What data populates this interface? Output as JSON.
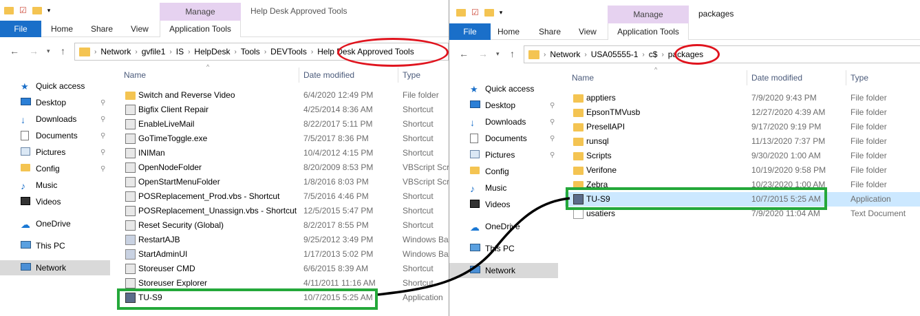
{
  "left_window": {
    "manage_tab": "Manage",
    "title": "Help Desk Approved Tools",
    "ribbon_tabs": [
      "File",
      "Home",
      "Share",
      "View",
      "Application Tools"
    ],
    "breadcrumb": [
      "Network",
      "gvfile1",
      "IS",
      "HelpDesk",
      "Tools",
      "DEVTools",
      "Help Desk Approved Tools"
    ],
    "columns": {
      "name": "Name",
      "date": "Date modified",
      "type": "Type"
    },
    "nav": [
      {
        "label": "Quick access",
        "icon": "star-icon",
        "pinned": false
      },
      {
        "label": "Desktop",
        "icon": "desktop-icon",
        "pinned": true
      },
      {
        "label": "Downloads",
        "icon": "download-icon",
        "pinned": true
      },
      {
        "label": "Documents",
        "icon": "documents-icon",
        "pinned": true
      },
      {
        "label": "Pictures",
        "icon": "pictures-icon",
        "pinned": true
      },
      {
        "label": "Config",
        "icon": "folder-icon",
        "pinned": true
      },
      {
        "label": "Music",
        "icon": "music-icon",
        "pinned": false
      },
      {
        "label": "Videos",
        "icon": "videos-icon",
        "pinned": false
      },
      {
        "label": "OneDrive",
        "icon": "cloud-icon",
        "pinned": false
      },
      {
        "label": "This PC",
        "icon": "computer-icon",
        "pinned": false
      },
      {
        "label": "Network",
        "icon": "network-icon",
        "pinned": false
      }
    ],
    "files": [
      {
        "name": "Switch and Reverse Video",
        "date": "6/4/2020 12:49 PM",
        "type": "File folder",
        "icon": "folder"
      },
      {
        "name": "Bigfix Client Repair",
        "date": "4/25/2014 8:36 AM",
        "type": "Shortcut",
        "icon": "sc"
      },
      {
        "name": "EnableLiveMail",
        "date": "8/22/2017 5:11 PM",
        "type": "Shortcut",
        "icon": "sc"
      },
      {
        "name": "GoTimeToggle.exe",
        "date": "7/5/2017 8:36 PM",
        "type": "Shortcut",
        "icon": "sc"
      },
      {
        "name": "INIMan",
        "date": "10/4/2012 4:15 PM",
        "type": "Shortcut",
        "icon": "sc"
      },
      {
        "name": "OpenNodeFolder",
        "date": "8/20/2009 8:53 PM",
        "type": "VBScript Scri",
        "icon": "sc"
      },
      {
        "name": "OpenStartMenuFolder",
        "date": "1/8/2016 8:03 PM",
        "type": "VBScript Scri",
        "icon": "sc"
      },
      {
        "name": "POSReplacement_Prod.vbs - Shortcut",
        "date": "7/5/2016 4:46 PM",
        "type": "Shortcut",
        "icon": "sc"
      },
      {
        "name": "POSReplacement_Unassign.vbs - Shortcut",
        "date": "12/5/2015 5:47 PM",
        "type": "Shortcut",
        "icon": "sc"
      },
      {
        "name": "Reset Security (Global)",
        "date": "8/2/2017 8:55 PM",
        "type": "Shortcut",
        "icon": "sc"
      },
      {
        "name": "RestartAJB",
        "date": "9/25/2012 3:49 PM",
        "type": "Windows Bat",
        "icon": "bat"
      },
      {
        "name": "StartAdminUI",
        "date": "1/17/2013 5:02 PM",
        "type": "Windows Bat",
        "icon": "bat"
      },
      {
        "name": "Storeuser CMD",
        "date": "6/6/2015 8:39 AM",
        "type": "Shortcut",
        "icon": "sc"
      },
      {
        "name": "Storeuser Explorer",
        "date": "4/11/2011 11:16 AM",
        "type": "Shortcut",
        "icon": "sc"
      },
      {
        "name": "TU-S9",
        "date": "10/7/2015 5:25 AM",
        "type": "Application",
        "icon": "app"
      }
    ]
  },
  "right_window": {
    "manage_tab": "Manage",
    "title": "packages",
    "ribbon_tabs": [
      "File",
      "Home",
      "Share",
      "View",
      "Application Tools"
    ],
    "breadcrumb": [
      "Network",
      "USA05555-1",
      "c$",
      "packages"
    ],
    "columns": {
      "name": "Name",
      "date": "Date modified",
      "type": "Type"
    },
    "nav": [
      {
        "label": "Quick access",
        "icon": "star-icon",
        "pinned": false
      },
      {
        "label": "Desktop",
        "icon": "desktop-icon",
        "pinned": true
      },
      {
        "label": "Downloads",
        "icon": "download-icon",
        "pinned": true
      },
      {
        "label": "Documents",
        "icon": "documents-icon",
        "pinned": true
      },
      {
        "label": "Pictures",
        "icon": "pictures-icon",
        "pinned": true
      },
      {
        "label": "Config",
        "icon": "folder-icon",
        "pinned": false
      },
      {
        "label": "Music",
        "icon": "music-icon",
        "pinned": false
      },
      {
        "label": "Videos",
        "icon": "videos-icon",
        "pinned": false
      },
      {
        "label": "OneDrive",
        "icon": "cloud-icon",
        "pinned": false
      },
      {
        "label": "This PC",
        "icon": "computer-icon",
        "pinned": false
      },
      {
        "label": "Network",
        "icon": "network-icon",
        "pinned": false
      }
    ],
    "files": [
      {
        "name": "apptiers",
        "date": "7/9/2020 9:43 PM",
        "type": "File folder",
        "icon": "folder"
      },
      {
        "name": "EpsonTMVusb",
        "date": "12/27/2020 4:39 AM",
        "type": "File folder",
        "icon": "folder"
      },
      {
        "name": "PresellAPI",
        "date": "9/17/2020 9:19 PM",
        "type": "File folder",
        "icon": "folder"
      },
      {
        "name": "runsql",
        "date": "11/13/2020 7:37 PM",
        "type": "File folder",
        "icon": "folder"
      },
      {
        "name": "Scripts",
        "date": "9/30/2020 1:00 AM",
        "type": "File folder",
        "icon": "folder"
      },
      {
        "name": "Verifone",
        "date": "10/19/2020 9:58 PM",
        "type": "File folder",
        "icon": "folder"
      },
      {
        "name": "Zebra",
        "date": "10/23/2020 1:00 AM",
        "type": "File folder",
        "icon": "folder"
      },
      {
        "name": "TU-S9",
        "date": "10/7/2015 5:25 AM",
        "type": "Application",
        "icon": "app"
      },
      {
        "name": "usatiers",
        "date": "7/9/2020 11:04 AM",
        "type": "Text Document",
        "icon": "txt"
      }
    ]
  },
  "colors": {
    "red_annotation": "#e0141e",
    "green_annotation": "#24a83a",
    "file_tab": "#1a6fc9",
    "manage_tab": "#e6d2f0",
    "selected_row": "#cce8ff"
  }
}
